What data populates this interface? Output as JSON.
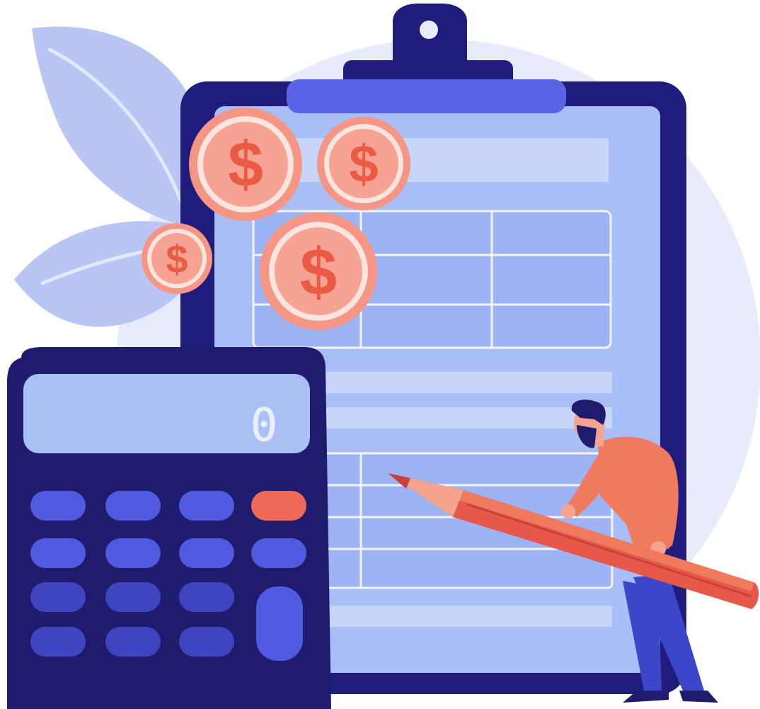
{
  "illustration": {
    "subject": "tax-and-budget-accounting",
    "calculator": {
      "display_value": "0",
      "key_rows": 4,
      "key_columns": 4
    },
    "coins": {
      "symbol": "$",
      "count": 4
    },
    "icons": [
      "clipboard-icon",
      "calculator-icon",
      "coin-icon",
      "pencil-icon",
      "leaf-icon",
      "person-icon"
    ],
    "colors": {
      "background": "#ffffff",
      "circle_backdrop": "#e7ebfb",
      "leaf": "#b9c6f3",
      "leaf_vein": "#e3e9fc",
      "clipboard_board": "#1f1c7e",
      "clipboard_sheet": "#a9bdf6",
      "clipboard_clip": "#5a63e6",
      "sheet_row": "#c7d5fa",
      "sheet_line": "#f2f5ff",
      "calculator_body": "#1f1c6e",
      "calculator_display": "#a8c0f4",
      "key_blue": "#4f5ae0",
      "key_dark": "#3e45c0",
      "key_accent": "#ee6a56",
      "coin_fill": "#f59685",
      "coin_inner": "#fde4df",
      "coin_symbol": "#ea5a44",
      "pencil_body": "#e7584a",
      "person_shirt": "#f07a5e",
      "person_pants": "#3c46c8",
      "person_hair": "#1f1c6e"
    }
  }
}
